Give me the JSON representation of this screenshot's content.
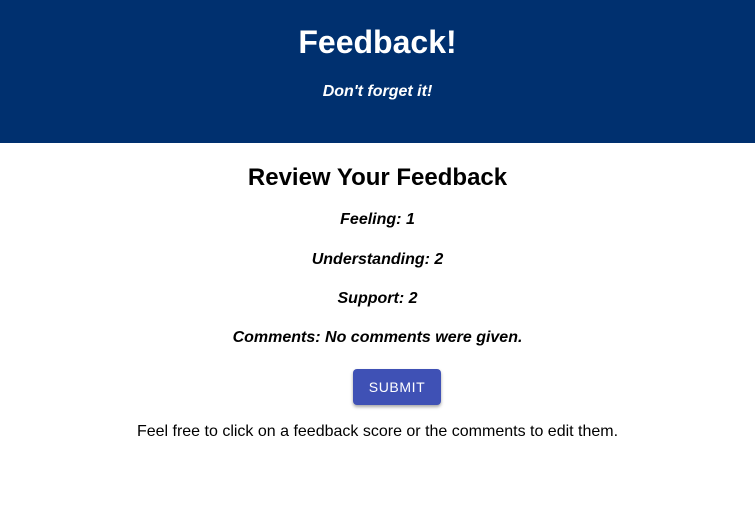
{
  "header": {
    "title": "Feedback!",
    "subtitle": "Don't forget it!",
    "background_color": "#00306f"
  },
  "review": {
    "title": "Review Your Feedback",
    "feeling": "Feeling: 1",
    "understanding": "Understanding: 2",
    "support": "Support: 2",
    "comments": "Comments: No comments were given."
  },
  "submit": {
    "label": "SUBMIT",
    "color": "#3f51b5"
  },
  "hint": "Feel free to click on a feedback score or the comments to edit them."
}
